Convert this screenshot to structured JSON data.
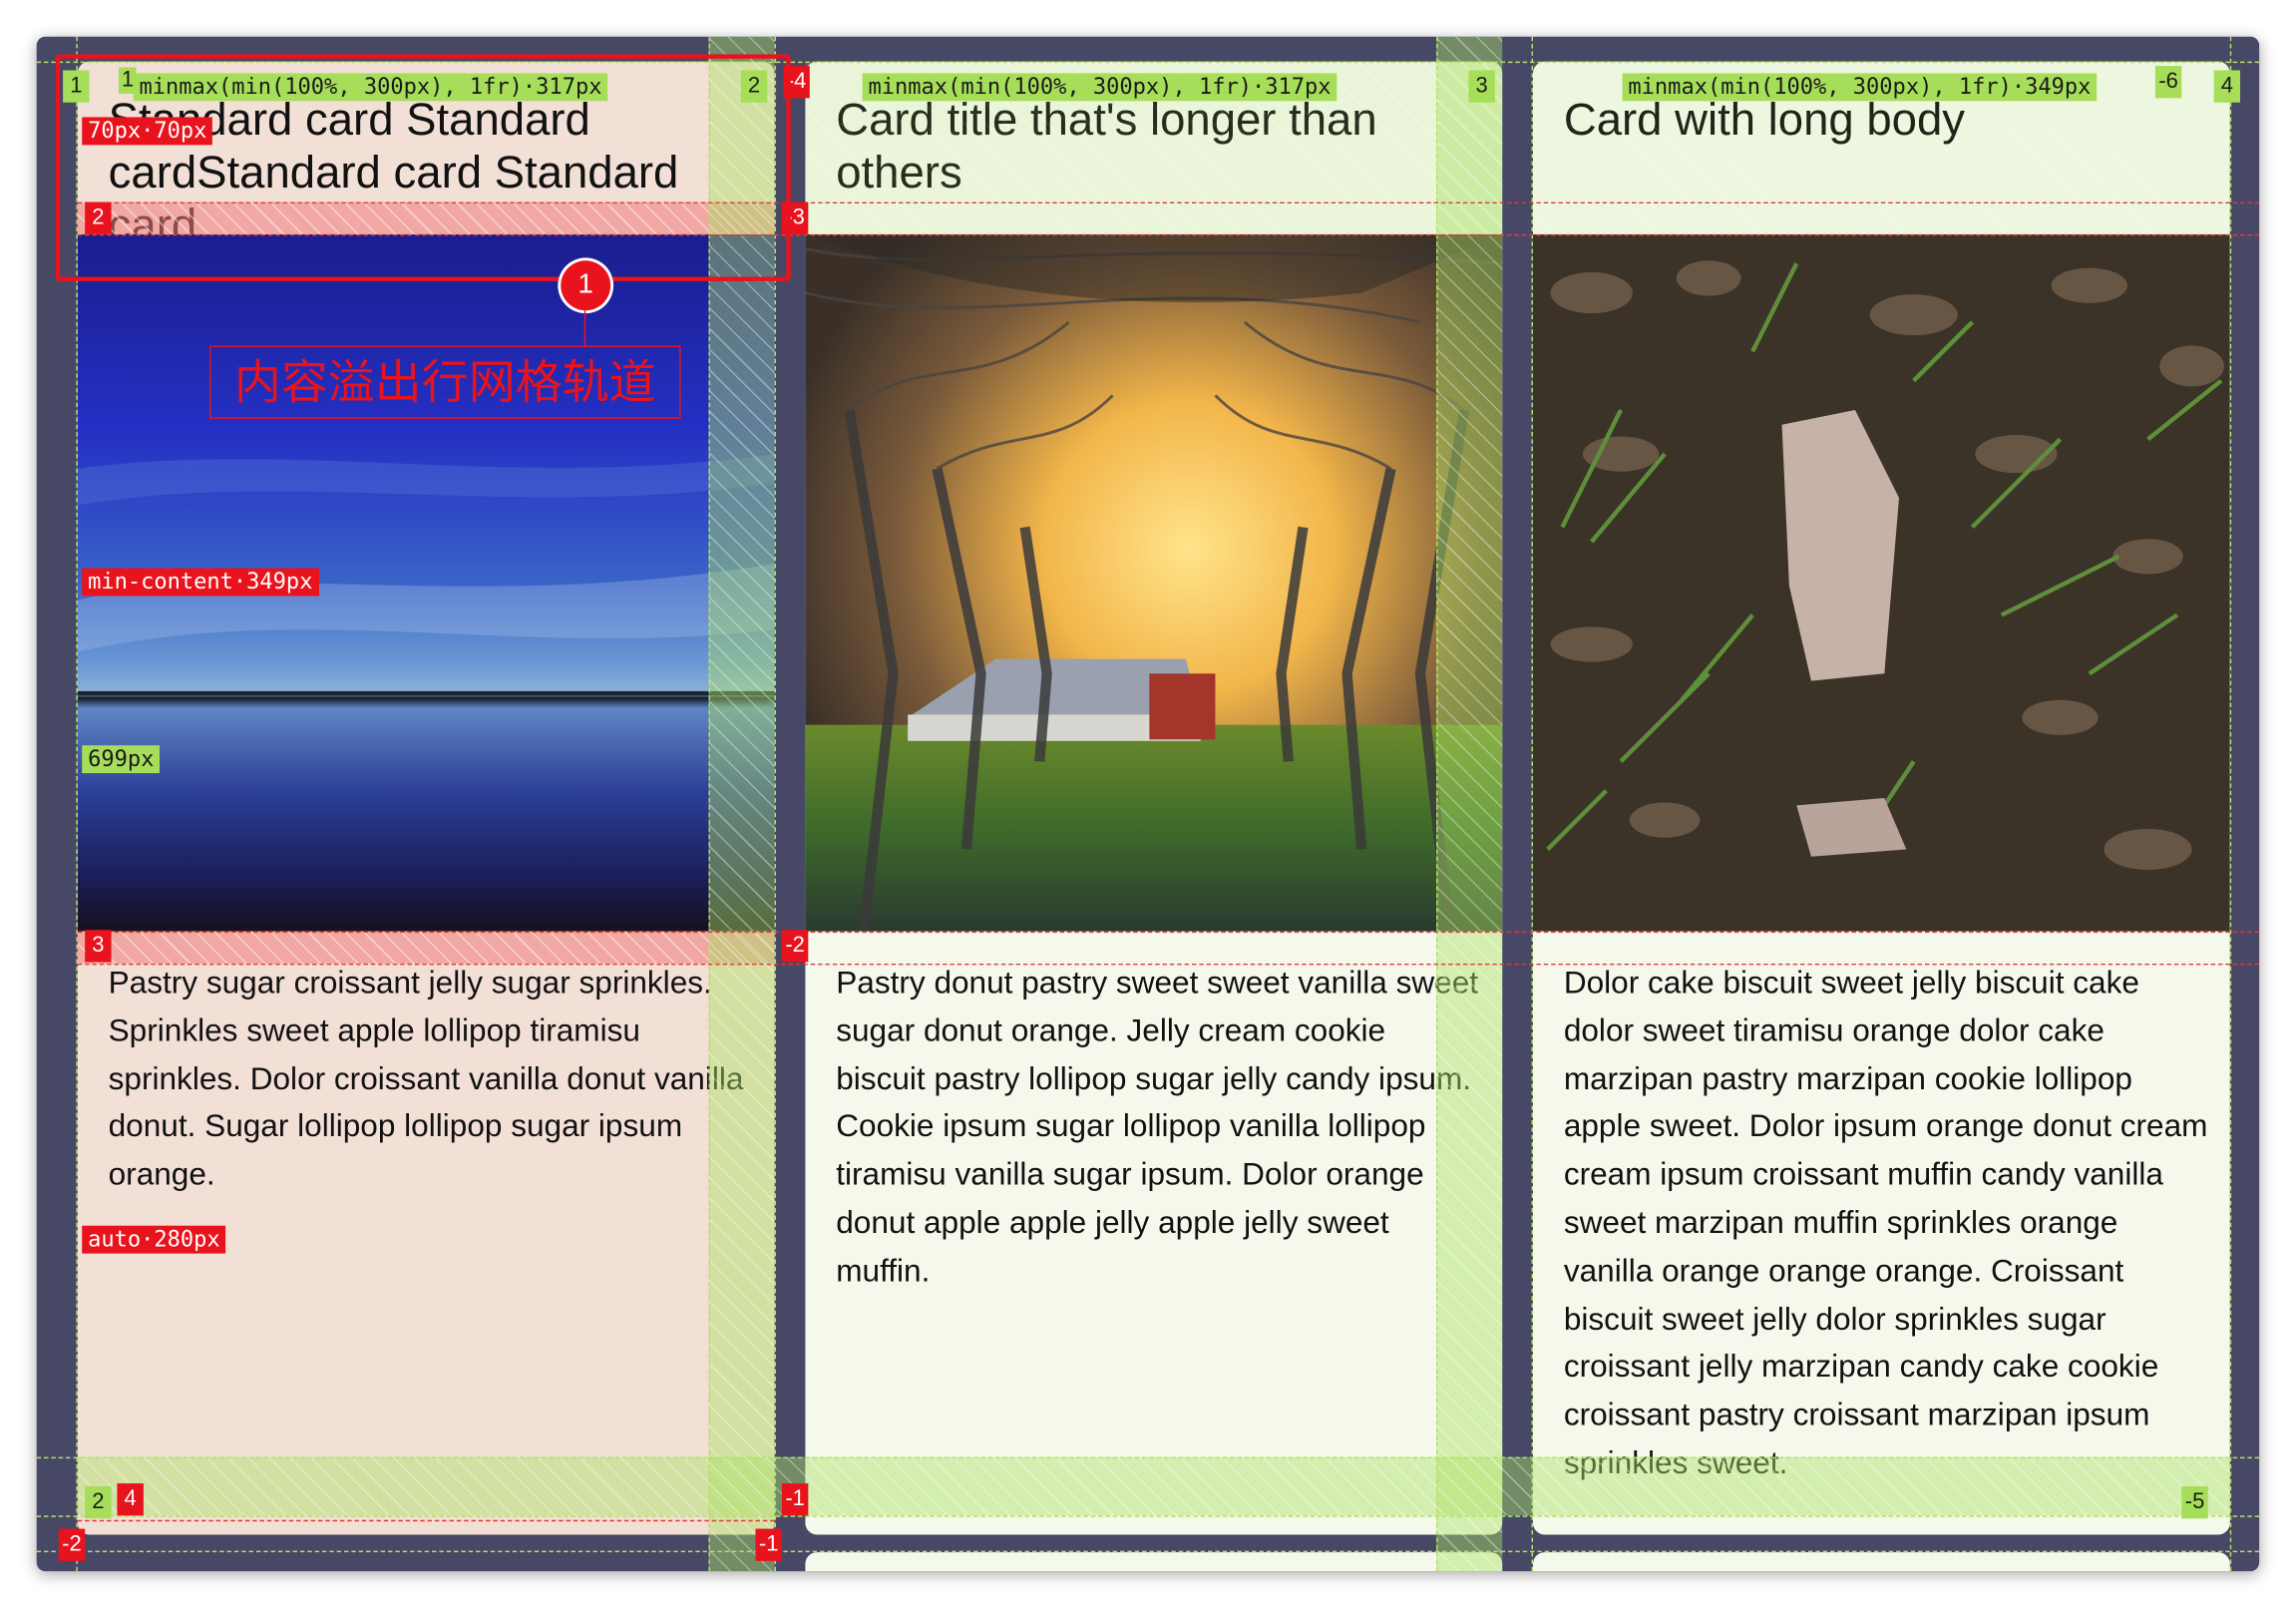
{
  "cards": [
    {
      "title": "Standard card Standard cardStandard card Standard card",
      "image": "sky-over-lake-image",
      "body": "Pastry sugar croissant jelly sugar sprinkles. Sprinkles sweet apple lollipop tiramisu sprinkles. Dolor croissant vanilla donut vanilla donut. Sugar lollipop lollipop sugar ipsum orange."
    },
    {
      "title": "Card title that's longer than others",
      "image": "orchard-trees-barn-image",
      "body": "Pastry donut pastry sweet sweet vanilla sweet sugar donut orange. Jelly cream cookie biscuit pastry lollipop sugar jelly candy ipsum. Cookie ipsum sugar lollipop vanilla lollipop tiramisu vanilla sugar ipsum. Dolor orange donut apple apple jelly apple jelly sweet muffin."
    },
    {
      "title": "Card with long body",
      "image": "rock-and-leaves-ground-image",
      "body": "Dolor cake biscuit sweet jelly biscuit cake dolor sweet tiramisu orange dolor cake marzipan pastry marzipan cookie lollipop apple sweet. Dolor ipsum orange donut cream cream ipsum croissant muffin candy vanilla sweet marzipan muffin sprinkles orange vanilla orange orange orange. Croissant biscuit sweet jelly dolor sprinkles sugar croissant jelly marzipan candy cake cookie croissant pastry croissant marzipan ipsum sprinkles sweet."
    }
  ],
  "grid_overlay": {
    "column_track_labels": [
      "minmax(min(100%, 300px), 1fr)·317px",
      "minmax(min(100%, 300px), 1fr)·317px",
      "minmax(min(100%, 300px), 1fr)·349px"
    ],
    "row_track_labels": {
      "title_row": "70px·70px",
      "image_row": "min-content·349px",
      "card_outer_row": "699px",
      "body_row": "auto·280px"
    },
    "outer_line_numbers": {
      "columns_positive": [
        "1",
        "2",
        "3",
        "4"
      ],
      "columns_negative": [
        "-4",
        "-6"
      ],
      "rows_positive": [
        "2"
      ],
      "rows_negative": [
        "-2",
        "-5"
      ]
    },
    "subgrid_line_numbers": {
      "columns_positive": [
        "1",
        "2"
      ],
      "columns_negative": [
        "-3",
        "-2",
        "-1",
        "-1"
      ],
      "rows_positive": [
        "2",
        "3",
        "4"
      ],
      "rows_negative": [
        "-1"
      ]
    }
  },
  "annotation": {
    "marker": "1",
    "label": "内容溢出行网格轨道"
  },
  "colors": {
    "container_bg": "#464866",
    "card_bg": "#f4f9ec",
    "highlighted_card_bg": "#f2e0d6",
    "grid_overlay_green": "#a6de5a",
    "grid_overlay_red": "#e8131c"
  }
}
